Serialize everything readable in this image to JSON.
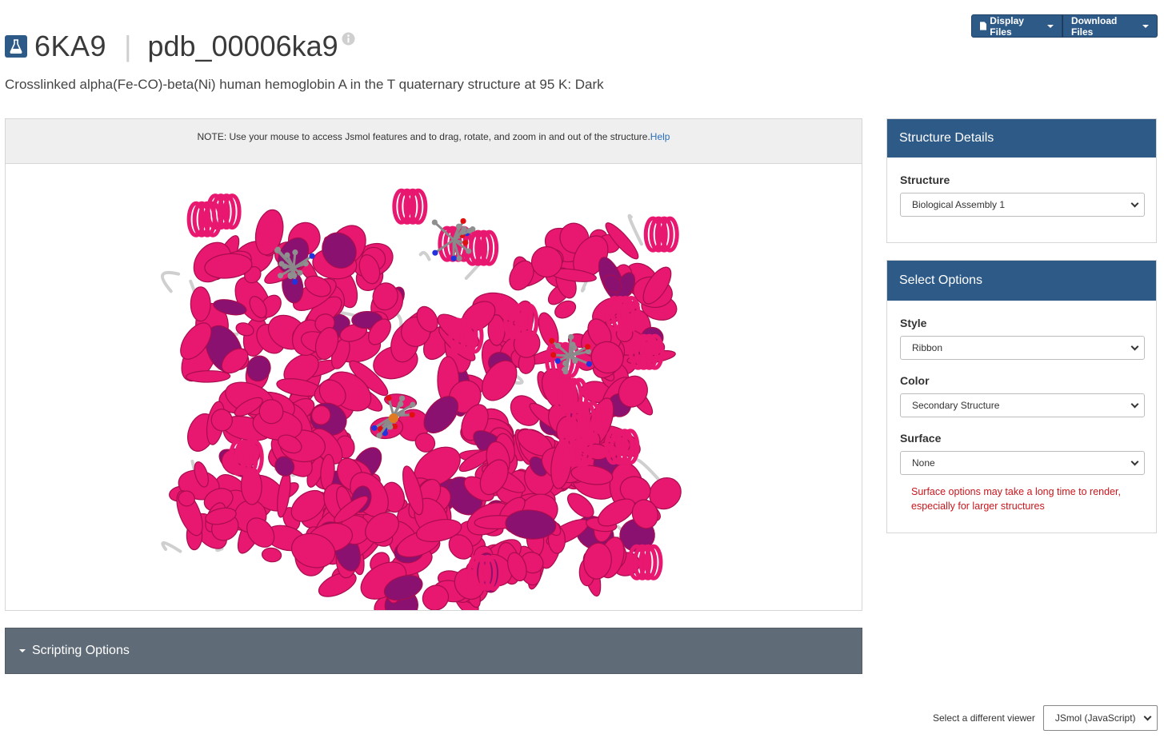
{
  "header": {
    "entry_id": "6KA9",
    "separator": "|",
    "alt_id": "pdb_00006ka9",
    "subtitle": "Crosslinked alpha(Fe-CO)-beta(Ni) human hemoglobin A in the T quaternary structure at 95 K: Dark"
  },
  "toolbar": {
    "display_files_label": "Display Files",
    "download_files_label": "Download Files"
  },
  "viewer": {
    "note_text": "NOTE: Use your mouse to access Jsmol features and to drag, rotate, and zoom in and out of the structure.",
    "help_link": "Help"
  },
  "scripting": {
    "label": "Scripting Options"
  },
  "structure_details": {
    "title": "Structure Details",
    "structure_label": "Structure",
    "structure_value": "Biological Assembly 1"
  },
  "select_options": {
    "title": "Select Options",
    "style_label": "Style",
    "style_value": "Ribbon",
    "color_label": "Color",
    "color_value": "Secondary Structure",
    "surface_label": "Surface",
    "surface_value": "None",
    "surface_warning": "Surface options may take a long time to render, especially for larger structures"
  },
  "viewer_switch": {
    "label": "Select a different viewer",
    "value": "JSmol (JavaScript)"
  },
  "colors": {
    "brand_blue": "#2e5a87",
    "helix_pink": "#e8176f",
    "sheet_purple": "#8a1170",
    "scripting_bar": "#5f6b77",
    "warning_red": "#c9161c"
  }
}
